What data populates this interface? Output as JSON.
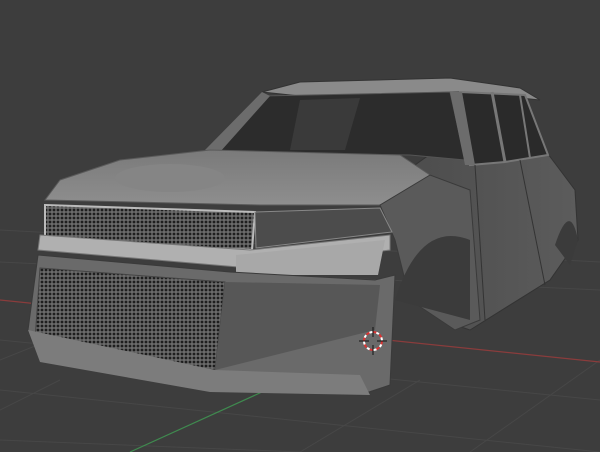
{
  "viewport": {
    "background": "#3d3d3d",
    "grid_color": "#474747",
    "x_axis_color": "#9a3a3a",
    "y_axis_color": "#3f8a4f"
  },
  "model": {
    "body_color": "#5e5e5e",
    "highlight_color": "#a9a9a9",
    "glass_color": "#2a2a2a",
    "grille_color": "#262626"
  },
  "cursor": {
    "icon": "3d-cursor-icon"
  }
}
